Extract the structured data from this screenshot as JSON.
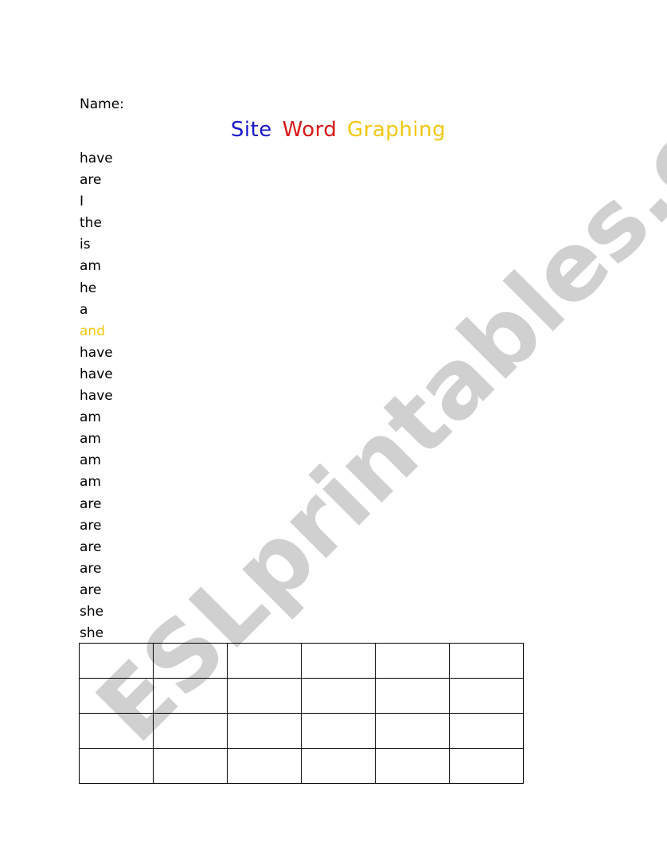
{
  "header": {
    "name_label": "Name:"
  },
  "title": {
    "parts": [
      {
        "text": "Site",
        "color": "#1a1ac8"
      },
      {
        "text": "Word",
        "color": "#d81818"
      },
      {
        "text": "Graphing",
        "color": "#f0c814"
      }
    ]
  },
  "words": [
    {
      "text": "have"
    },
    {
      "text": "are"
    },
    {
      "text": "I"
    },
    {
      "text": "the"
    },
    {
      "text": "is"
    },
    {
      "text": "am"
    },
    {
      "text": "he"
    },
    {
      "text": "a"
    },
    {
      "text": "and",
      "color": "#f0c814"
    },
    {
      "text": "have"
    },
    {
      "text": "have"
    },
    {
      "text": "have"
    },
    {
      "text": "am"
    },
    {
      "text": "am"
    },
    {
      "text": "am"
    },
    {
      "text": "am"
    },
    {
      "text": "are"
    },
    {
      "text": "are"
    },
    {
      "text": "are"
    },
    {
      "text": "are"
    },
    {
      "text": "are"
    },
    {
      "text": "she"
    },
    {
      "text": "she"
    }
  ],
  "grid": {
    "rows": 4,
    "columns": 6
  },
  "watermark": "ESLprintables.com"
}
